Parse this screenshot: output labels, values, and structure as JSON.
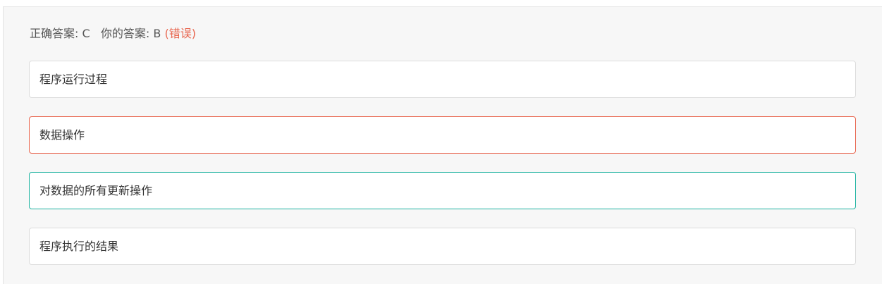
{
  "result": {
    "correct_label": "正确答案: C",
    "yours_label": "你的答案: B",
    "status": "(错误)",
    "status_color": "#e8664f"
  },
  "options": [
    {
      "text": "程序运行过程",
      "state": "normal"
    },
    {
      "text": "数据操作",
      "state": "wrong",
      "color": "#e8664f"
    },
    {
      "text": "对数据的所有更新操作",
      "state": "correct",
      "color": "#1fb3a1"
    },
    {
      "text": "程序执行的结果",
      "state": "normal"
    }
  ]
}
